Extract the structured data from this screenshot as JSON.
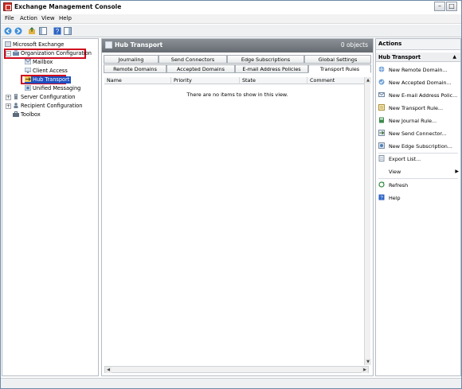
{
  "window": {
    "title": "Exchange Management Console"
  },
  "menu": [
    "File",
    "Action",
    "View",
    "Help"
  ],
  "tree": {
    "root": "Microsoft Exchange",
    "org_config": "Organization Configuration",
    "mailbox": "Mailbox",
    "client_access": "Client Access",
    "hub_transport": "Hub Transport",
    "unified_messaging": "Unified Messaging",
    "server_config": "Server Configuration",
    "recipient_config": "Recipient Configuration",
    "toolbox": "Toolbox"
  },
  "center": {
    "title": "Hub Transport",
    "count": "0 objects",
    "tabs_row1": [
      "Journaling",
      "Send Connectors",
      "Edge Subscriptions",
      "Global Settings"
    ],
    "tabs_row2": [
      "Remote Domains",
      "Accepted Domains",
      "E-mail Address Policies",
      "Transport Rules"
    ],
    "active_tab": "Transport Rules",
    "columns": [
      "Name",
      "Priority",
      "State",
      "Comment"
    ],
    "empty_text": "There are no items to show in this view."
  },
  "actions": {
    "title": "Actions",
    "section": "Hub Transport",
    "items": [
      "New Remote Domain...",
      "New Accepted Domain...",
      "New E-mail Address Polic...",
      "New Transport Rule...",
      "New Journal Rule...",
      "New Send Connector...",
      "New Edge Subscription...",
      "Export List...",
      "View",
      "Refresh",
      "Help"
    ]
  },
  "colors": {
    "highlight": "#d00a1e",
    "selection": "#1f4fbf",
    "header_bg": "#757b81"
  }
}
